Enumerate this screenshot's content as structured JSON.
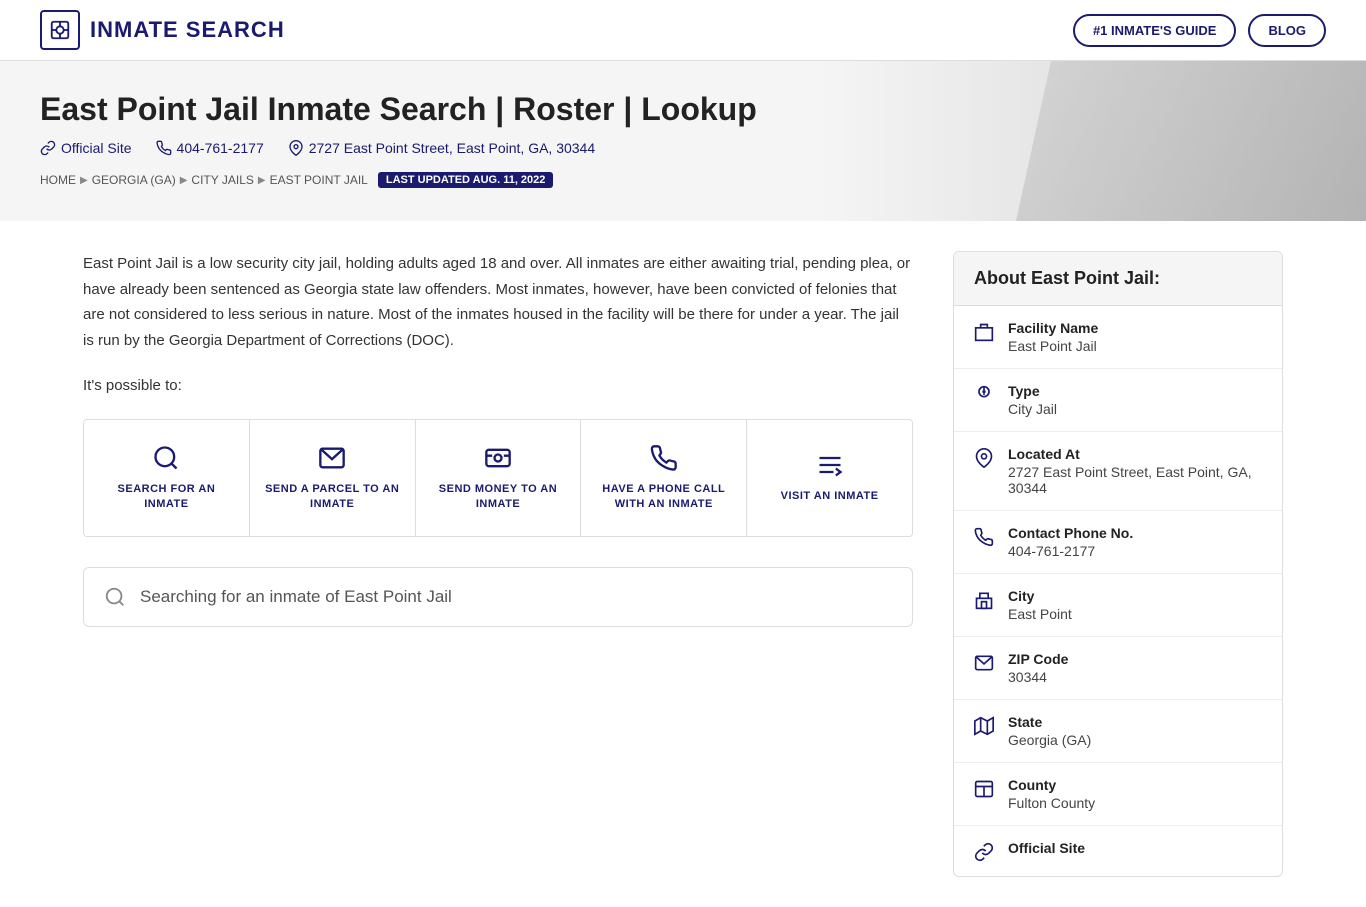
{
  "header": {
    "logo_text": "INMATE SEARCH",
    "nav_guide": "#1 INMATE'S GUIDE",
    "nav_blog": "BLOG"
  },
  "hero": {
    "title": "East Point Jail Inmate Search | Roster | Lookup",
    "official_site": "Official Site",
    "phone": "404-761-2177",
    "address": "2727 East Point Street, East Point, GA, 30344"
  },
  "breadcrumb": {
    "home": "HOME",
    "state": "GEORGIA (GA)",
    "city_jails": "CITY JAILS",
    "facility": "EAST POINT JAIL",
    "last_updated": "LAST UPDATED AUG. 11, 2022"
  },
  "content": {
    "description": "East Point Jail is a low security city jail, holding adults aged 18 and over. All inmates are either awaiting trial, pending plea, or have already been sentenced as Georgia state law offenders. Most inmates, however, have been convicted of felonies that are not considered to less serious in nature. Most of the inmates housed in the facility will be there for under a year. The jail is run by the Georgia Department of Corrections (DOC).",
    "possible_label": "It's possible to:",
    "actions": [
      {
        "id": "search",
        "label": "SEARCH FOR AN INMATE",
        "icon": "search"
      },
      {
        "id": "parcel",
        "label": "SEND A PARCEL TO AN INMATE",
        "icon": "parcel"
      },
      {
        "id": "money",
        "label": "SEND MONEY TO AN INMATE",
        "icon": "money"
      },
      {
        "id": "phone",
        "label": "HAVE A PHONE CALL WITH AN INMATE",
        "icon": "phone"
      },
      {
        "id": "visit",
        "label": "VISIT AN INMATE",
        "icon": "visit"
      }
    ],
    "search_placeholder": "Searching for an inmate of East Point Jail"
  },
  "sidebar": {
    "title": "About East Point Jail:",
    "rows": [
      {
        "id": "facility",
        "label": "Facility Name",
        "value": "East Point Jail",
        "icon": "building"
      },
      {
        "id": "type",
        "label": "Type",
        "value": "City Jail",
        "icon": "tag"
      },
      {
        "id": "located_at",
        "label": "Located At",
        "value": "2727 East Point Street, East Point, GA, 30344",
        "icon": "location"
      },
      {
        "id": "phone",
        "label": "Contact Phone No.",
        "value": "404-761-2177",
        "icon": "phone"
      },
      {
        "id": "city",
        "label": "City",
        "value": "East Point",
        "icon": "building2"
      },
      {
        "id": "zip",
        "label": "ZIP Code",
        "value": "30344",
        "icon": "mail"
      },
      {
        "id": "state",
        "label": "State",
        "value": "Georgia (GA)",
        "icon": "map"
      },
      {
        "id": "county",
        "label": "County",
        "value": "Fulton County",
        "icon": "county"
      },
      {
        "id": "official",
        "label": "Official Site",
        "value": "",
        "icon": "link"
      }
    ]
  }
}
